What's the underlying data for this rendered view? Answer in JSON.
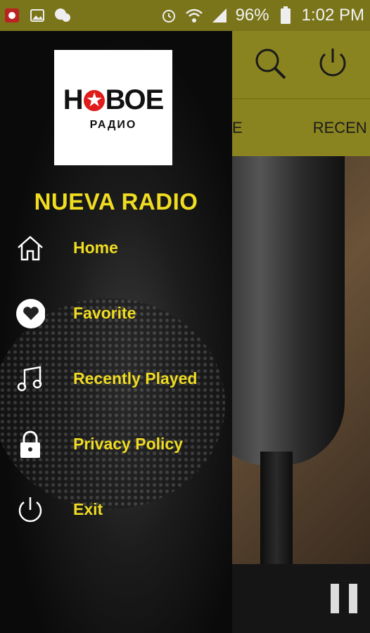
{
  "status_bar": {
    "battery_percent": "96%",
    "time": "1:02 PM"
  },
  "app": {
    "tabs_visible": [
      "E",
      "RECEN"
    ]
  },
  "drawer": {
    "logo_text": "НОВОЕ",
    "logo_subtitle": "РАДИО",
    "station_name": "NUEVA RADIO",
    "items": [
      {
        "label": "Home",
        "icon": "home-icon"
      },
      {
        "label": "Favorite",
        "icon": "heart-icon"
      },
      {
        "label": "Recently Played",
        "icon": "music-note-icon"
      },
      {
        "label": "Privacy Policy",
        "icon": "lock-icon"
      },
      {
        "label": "Exit",
        "icon": "power-icon"
      }
    ]
  },
  "colors": {
    "accent_yellow": "#f0dc21",
    "appbar_olive": "#8a8420",
    "status_olive": "#7a741a"
  }
}
